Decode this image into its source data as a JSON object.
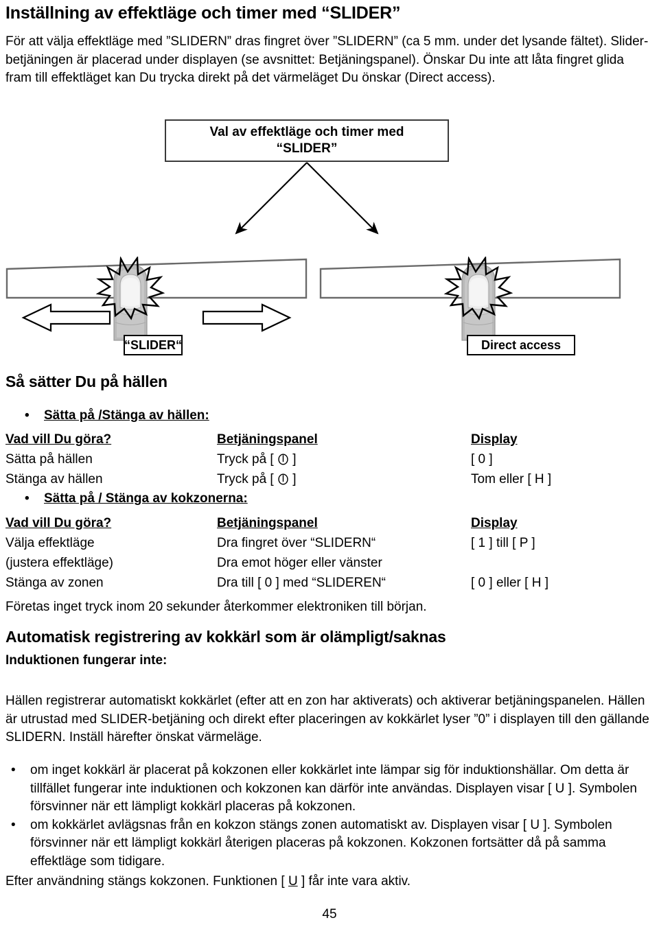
{
  "document": {
    "title": "Inställning av effektläge och timer med “SLIDER”",
    "intro": "För att välja effektläge med ”SLIDERN” dras fingret över ”SLIDERN” (ca 5 mm. under det lysande fältet). Slider-betjäningen är placerad under displayen (se avsnittet: Betjäningspanel). Önskar Du inte att låta fingret glida fram till effektläget kan Du trycka direkt på det värmeläget Du önskar (Direct access).",
    "page_number": "45"
  },
  "diagram": {
    "top_box_line1": "Val av effektläge och timer med",
    "top_box_line2": "“SLIDER”",
    "left_label": "“SLIDER“",
    "right_label": "Direct access",
    "left_arrow_icon": "arrow-left-icon",
    "right_arrow_icon": "arrow-right-icon",
    "finger_icon": "finger-icon",
    "burst_icon": "burst-icon",
    "connector_icon": "branch-arrows-icon"
  },
  "section_on": {
    "heading": "Så sätter Du på hällen",
    "bullet": "Sätta på /Stänga av hällen:",
    "table": {
      "headers": [
        "Vad vill Du göra?",
        "Betjäningspanel",
        "Display"
      ],
      "rows": [
        {
          "c1": "Sätta på hällen",
          "c2_pre": "Tryck på [ ",
          "c2_icon": "power-symbol-icon",
          "c2_post": " ]",
          "c3": "[ 0 ]"
        },
        {
          "c1": "Stänga av hällen",
          "c2_pre": "Tryck på [ ",
          "c2_icon": "power-symbol-icon",
          "c2_post": " ]",
          "c3": "Tom eller [ H ]"
        }
      ]
    }
  },
  "section_zones": {
    "bullet": "Sätta på / Stänga av kokzonerna:",
    "table": {
      "headers": [
        "Vad vill Du göra?",
        "Betjäningspanel",
        "Display"
      ],
      "rows": [
        {
          "c1": "Välja effektläge",
          "c2": "Dra fingret över “SLIDERN“",
          "c3": "[ 1 ] till [ P ]"
        },
        {
          "c1": "(justera effektläge)",
          "c2": "Dra emot höger eller vänster",
          "c3": ""
        },
        {
          "c1": "Stänga av zonen",
          "c2": "Dra till [ 0 ] med “SLIDEREN“",
          "c3": "[ 0 ] eller [ H ]"
        }
      ]
    },
    "note": "Företas inget tryck inom 20 sekunder återkommer elektroniken till början."
  },
  "section_auto": {
    "heading": "Automatisk registrering av kokkärl som är olämpligt/saknas",
    "subheading": "Induktionen fungerar inte:",
    "paragraph": "Hällen registrerar automatiskt kokkärlet (efter att en zon har aktiverats) och aktiverar betjäningspanelen. Hällen är utrustad med SLIDER-betjäning och direkt efter placeringen av kokkärlet lyser ”0” i displayen till den gällande SLIDERN. Inställ härefter önskat värmeläge.",
    "bullets": [
      "om inget kokkärl är placerat på kokzonen eller kokkärlet inte lämpar sig för induktionshällar. Om detta är tillfället fungerar inte induktionen och kokzonen kan därför inte användas. Displayen visar [ U ]. Symbolen försvinner när ett lämpligt kokkärl placeras på kokzonen.",
      "om kokkärlet avlägsnas från en kokzon stängs zonen automatiskt av. Displayen visar [ U ]. Symbolen försvinner när ett lämpligt kokkärl återigen placeras på kokzonen. Kokzonen fortsätter då på samma effektläge som tidigare."
    ],
    "footer_pre": "Efter användning stängs kokzonen. Funktionen [ ",
    "footer_u": "U",
    "footer_post": " ] får inte vara aktiv."
  },
  "colors": {
    "text": "#000000",
    "box_border": "#3a3a3a",
    "bar_border": "#666666",
    "finger_light": "#e8e8e8",
    "finger_mid": "#b8b8b8",
    "finger_dark": "#8c8c8c",
    "background": "#ffffff"
  }
}
